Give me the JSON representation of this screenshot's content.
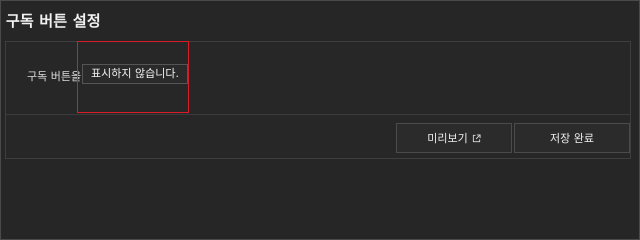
{
  "page": {
    "title": "구독 버튼 설정"
  },
  "setting": {
    "label": "구독 버튼을",
    "selected_value": "표시하지 않습니다."
  },
  "actions": {
    "preview_label": "미리보기",
    "save_label": "저장 완료"
  },
  "icons": {
    "preview": "external-link-icon"
  },
  "colors": {
    "highlight": "#d81c2a",
    "background": "#252526"
  }
}
